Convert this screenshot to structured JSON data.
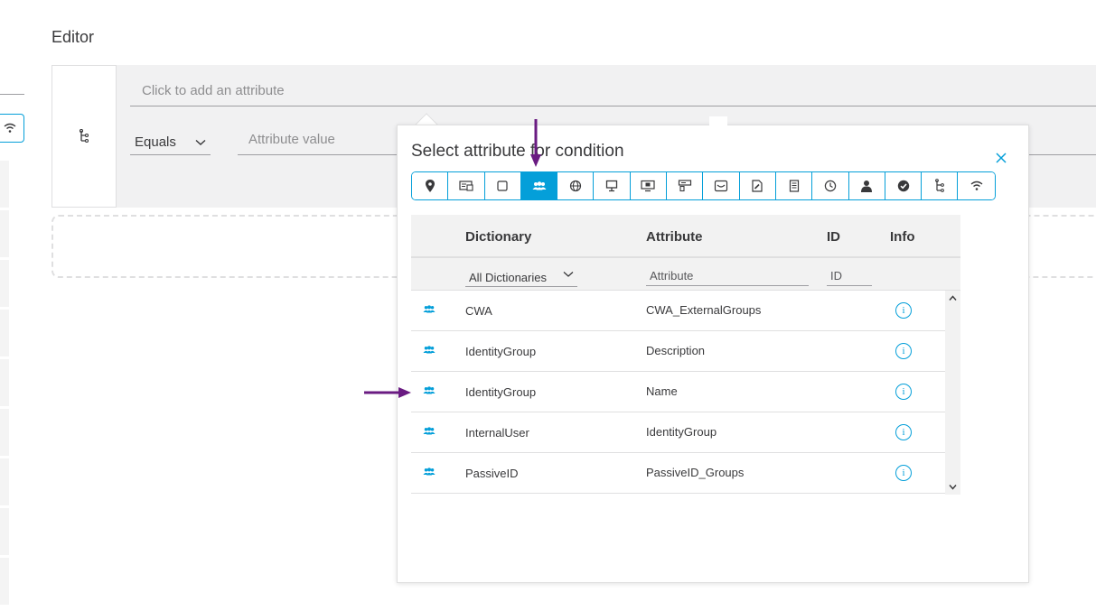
{
  "editor": {
    "title": "Editor",
    "attribute_placeholder": "Click to add an attribute",
    "operator": "Equals",
    "value_placeholder": "Attribute value"
  },
  "popover": {
    "title": "Select attribute for condition",
    "toolbar_icons": [
      "location-icon",
      "device-card-icon",
      "square-icon",
      "users-icon",
      "globe-icon",
      "monitor-icon",
      "screen-icon",
      "device-icon",
      "router-icon",
      "document-icon",
      "server-icon",
      "clock-icon",
      "user-icon",
      "checkmark-icon",
      "tree-icon",
      "wifi-icon"
    ],
    "active_tool": "users-icon"
  },
  "table": {
    "headers": {
      "dictionary": "Dictionary",
      "attribute": "Attribute",
      "id": "ID",
      "info": "Info"
    },
    "filters": {
      "dictionary": "All Dictionaries",
      "attribute": "Attribute",
      "id": "ID"
    },
    "rows": [
      {
        "dictionary": "CWA",
        "attribute": "CWA_ExternalGroups"
      },
      {
        "dictionary": "IdentityGroup",
        "attribute": "Description"
      },
      {
        "dictionary": "IdentityGroup",
        "attribute": "Name"
      },
      {
        "dictionary": "InternalUser",
        "attribute": "IdentityGroup"
      },
      {
        "dictionary": "PassiveID",
        "attribute": "PassiveID_Groups"
      }
    ]
  },
  "colors": {
    "accent": "#049fd9",
    "annotation": "#6a1b82"
  }
}
